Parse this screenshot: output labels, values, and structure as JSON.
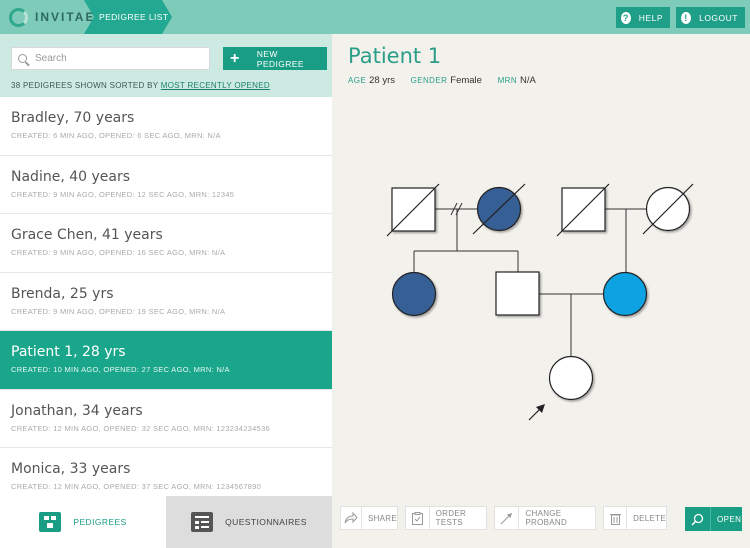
{
  "header": {
    "brand": "INVITAE",
    "breadcrumb": "PEDIGREE LIST",
    "help_label": "HELP",
    "logout_label": "LOGOUT"
  },
  "sidebar": {
    "search_placeholder": "Search",
    "new_pedigree_label": "NEW PEDIGREE",
    "sort_prefix": "38 PEDIGREES SHOWN SORTED BY",
    "sort_link": "MOST RECENTLY OPENED",
    "items": [
      {
        "name": "Bradley, 70 years",
        "meta": "CREATED: 6 MIN AGO, OPENED: 6 SEC AGO, MRN: N/A"
      },
      {
        "name": "Nadine, 40 years",
        "meta": "CREATED: 9 MIN AGO, OPENED: 12 SEC AGO, MRN: 12345"
      },
      {
        "name": "Grace Chen, 41 years",
        "meta": "CREATED: 9 MIN AGO, OPENED: 16 SEC AGO, MRN: N/A"
      },
      {
        "name": "Brenda, 25 yrs",
        "meta": "CREATED: 9 MIN AGO, OPENED: 19 SEC AGO, MRN: N/A"
      },
      {
        "name": "Patient 1, 28 yrs",
        "meta": "CREATED: 10 MIN AGO, OPENED: 27 SEC AGO, MRN: N/A"
      },
      {
        "name": "Jonathan, 34 years",
        "meta": "CREATED: 12 MIN AGO, OPENED: 32 SEC AGO, MRN: 123234234536"
      },
      {
        "name": "Monica, 33 years",
        "meta": "CREATED: 12 MIN AGO, OPENED: 37 SEC AGO, MRN: 1234567890"
      }
    ],
    "tabs": {
      "pedigrees": "PEDIGREES",
      "questionnaires": "QUESTIONNAIRES"
    }
  },
  "patient": {
    "title": "Patient 1",
    "age_label": "AGE",
    "age_value": "28 yrs",
    "gender_label": "GENDER",
    "gender_value": "Female",
    "mrn_label": "MRN",
    "mrn_value": "N/A"
  },
  "actions": {
    "share": "SHARE",
    "order_tests": "ORDER TESTS",
    "change_proband": "CHANGE PROBAND",
    "delete": "DELETE",
    "open": "OPEN"
  },
  "colors": {
    "brand": "#1a9d85",
    "topbar": "#7dcbb8",
    "affected_dark": "#345e95",
    "affected_light": "#0aa3e2"
  }
}
